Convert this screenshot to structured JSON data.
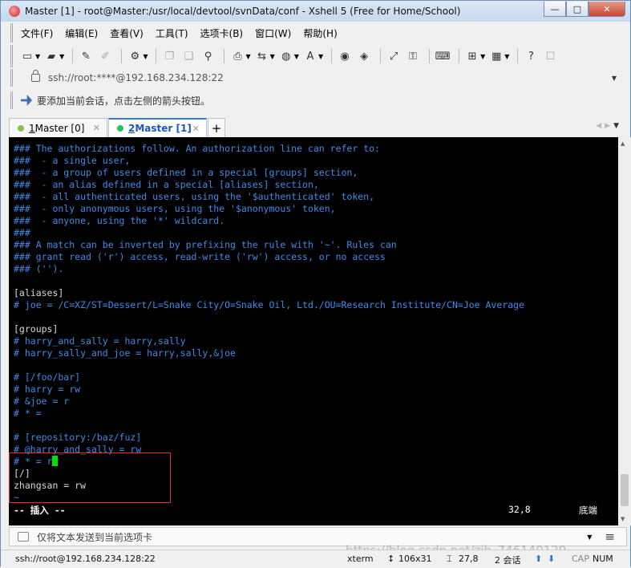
{
  "window": {
    "title": "Master [1] - root@Master:/usr/local/devtool/svnData/conf - Xshell 5 (Free for Home/School)",
    "minimize": "—",
    "maximize": "□",
    "close": "✕"
  },
  "menu": [
    "文件(F)",
    "编辑(E)",
    "查看(V)",
    "工具(T)",
    "选项卡(B)",
    "窗口(W)",
    "帮助(H)"
  ],
  "address": {
    "value": "ssh://root:****@192.168.234.128:22"
  },
  "hint": "要添加当前会话，点击左侧的箭头按钮。",
  "tabs": [
    {
      "number": "1",
      "label": " Master [0]",
      "color": "#8bc34a",
      "active": false
    },
    {
      "number": "2",
      "label": " Master [1]",
      "color": "#2fbf5f",
      "active": true
    }
  ],
  "tab_add": "+",
  "terminal": {
    "lines": [
      {
        "text": "### The authorizations follow. An authorization line can refer to:",
        "style": "c"
      },
      {
        "text": "###  - a single user,",
        "style": "c"
      },
      {
        "text": "###  - a group of users defined in a special [groups] section,",
        "style": "c"
      },
      {
        "text": "###  - an alias defined in a special [aliases] section,",
        "style": "c"
      },
      {
        "text": "###  - all authenticated users, using the '$authenticated' token,",
        "style": "c"
      },
      {
        "text": "###  - only anonymous users, using the '$anonymous' token,",
        "style": "c"
      },
      {
        "text": "###  - anyone, using the '*' wildcard.",
        "style": "c"
      },
      {
        "text": "###",
        "style": "c"
      },
      {
        "text": "### A match can be inverted by prefixing the rule with '~'. Rules can",
        "style": "c"
      },
      {
        "text": "### grant read ('r') access, read-write ('rw') access, or no access",
        "style": "c"
      },
      {
        "text": "### ('').",
        "style": "c"
      },
      {
        "text": "",
        "style": "w"
      },
      {
        "text": "[aliases]",
        "style": "w"
      },
      {
        "text": "# joe = /C=XZ/ST=Dessert/L=Snake City/O=Snake Oil, Ltd./OU=Research Institute/CN=Joe Average",
        "style": "c"
      },
      {
        "text": "",
        "style": "w"
      },
      {
        "text": "[groups]",
        "style": "w"
      },
      {
        "text": "# harry_and_sally = harry,sally",
        "style": "c"
      },
      {
        "text": "# harry_sally_and_joe = harry,sally,&joe",
        "style": "c"
      },
      {
        "text": "",
        "style": "w"
      },
      {
        "text": "# [/foo/bar]",
        "style": "c"
      },
      {
        "text": "# harry = rw",
        "style": "c"
      },
      {
        "text": "# &joe = r",
        "style": "c"
      },
      {
        "text": "# * =",
        "style": "c"
      },
      {
        "text": "",
        "style": "w"
      },
      {
        "text": "# [repository:/baz/fuz]",
        "style": "c"
      },
      {
        "text": "# @harry_and_sally = rw",
        "style": "c"
      },
      {
        "text": "# * = r",
        "style": "c"
      },
      {
        "text": "[/]",
        "style": "w"
      },
      {
        "text": "zhangsan = rw",
        "style": "w"
      },
      {
        "text": "~",
        "style": "c"
      }
    ],
    "mode": "-- 插入 --",
    "position": "32,8",
    "location": "底端"
  },
  "send_bar": "仅将文本发送到当前选项卡",
  "status": {
    "connection": "ssh://root@192.168.234.128:22",
    "terminal": "xterm",
    "size": "106x31",
    "cursor": "27,8",
    "sessions": "2 会话",
    "cap": "CAP",
    "num": "NUM"
  },
  "watermark": "https://blog.csdn.net/zjh_746140129"
}
